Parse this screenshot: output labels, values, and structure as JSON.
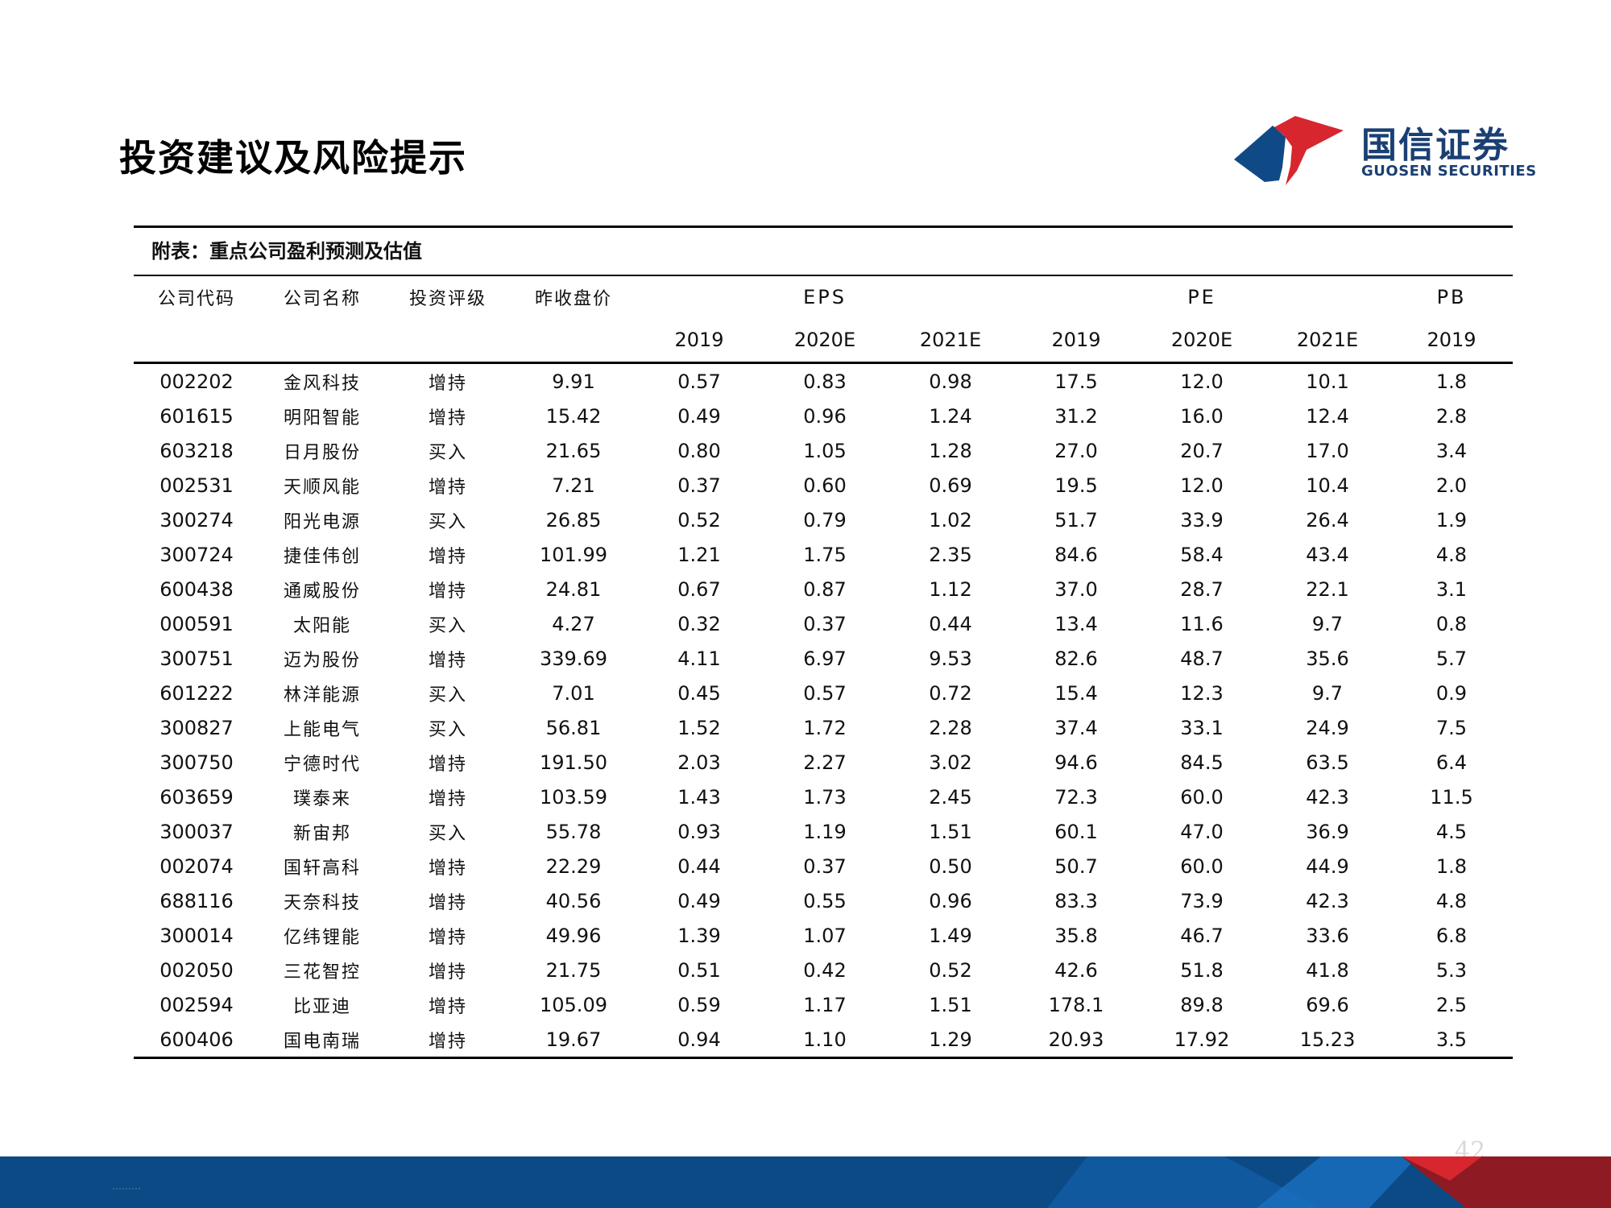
{
  "page": {
    "title": "投资建议及风险提示",
    "page_number": "42"
  },
  "logo": {
    "name_cn": "国信证券",
    "name_en": "GUOSEN SECURITIES"
  },
  "colors": {
    "brand_blue": "#0f4a86",
    "brand_red": "#d7262e",
    "footer_blue": "#0b4a85",
    "footer_red": "#8e1b24"
  },
  "table": {
    "caption": "附表：重点公司盈利预测及估值",
    "headers": {
      "code": "公司代码",
      "name": "公司名称",
      "rating": "投资评级",
      "price": "昨收盘价",
      "eps": "EPS",
      "pe": "PE",
      "pb": "PB",
      "years": [
        "2019",
        "2020E",
        "2021E",
        "2019",
        "2020E",
        "2021E",
        "2019"
      ]
    },
    "rows": [
      [
        "002202",
        "金风科技",
        "增持",
        "9.91",
        "0.57",
        "0.83",
        "0.98",
        "17.5",
        "12.0",
        "10.1",
        "1.8"
      ],
      [
        "601615",
        "明阳智能",
        "增持",
        "15.42",
        "0.49",
        "0.96",
        "1.24",
        "31.2",
        "16.0",
        "12.4",
        "2.8"
      ],
      [
        "603218",
        "日月股份",
        "买入",
        "21.65",
        "0.80",
        "1.05",
        "1.28",
        "27.0",
        "20.7",
        "17.0",
        "3.4"
      ],
      [
        "002531",
        "天顺风能",
        "增持",
        "7.21",
        "0.37",
        "0.60",
        "0.69",
        "19.5",
        "12.0",
        "10.4",
        "2.0"
      ],
      [
        "300274",
        "阳光电源",
        "买入",
        "26.85",
        "0.52",
        "0.79",
        "1.02",
        "51.7",
        "33.9",
        "26.4",
        "1.9"
      ],
      [
        "300724",
        "捷佳伟创",
        "增持",
        "101.99",
        "1.21",
        "1.75",
        "2.35",
        "84.6",
        "58.4",
        "43.4",
        "4.8"
      ],
      [
        "600438",
        "通威股份",
        "增持",
        "24.81",
        "0.67",
        "0.87",
        "1.12",
        "37.0",
        "28.7",
        "22.1",
        "3.1"
      ],
      [
        "000591",
        "太阳能",
        "买入",
        "4.27",
        "0.32",
        "0.37",
        "0.44",
        "13.4",
        "11.6",
        "9.7",
        "0.8"
      ],
      [
        "300751",
        "迈为股份",
        "增持",
        "339.69",
        "4.11",
        "6.97",
        "9.53",
        "82.6",
        "48.7",
        "35.6",
        "5.7"
      ],
      [
        "601222",
        "林洋能源",
        "买入",
        "7.01",
        "0.45",
        "0.57",
        "0.72",
        "15.4",
        "12.3",
        "9.7",
        "0.9"
      ],
      [
        "300827",
        "上能电气",
        "买入",
        "56.81",
        "1.52",
        "1.72",
        "2.28",
        "37.4",
        "33.1",
        "24.9",
        "7.5"
      ],
      [
        "300750",
        "宁德时代",
        "增持",
        "191.50",
        "2.03",
        "2.27",
        "3.02",
        "94.6",
        "84.5",
        "63.5",
        "6.4"
      ],
      [
        "603659",
        "璞泰来",
        "增持",
        "103.59",
        "1.43",
        "1.73",
        "2.45",
        "72.3",
        "60.0",
        "42.3",
        "11.5"
      ],
      [
        "300037",
        "新宙邦",
        "买入",
        "55.78",
        "0.93",
        "1.19",
        "1.51",
        "60.1",
        "47.0",
        "36.9",
        "4.5"
      ],
      [
        "002074",
        "国轩高科",
        "增持",
        "22.29",
        "0.44",
        "0.37",
        "0.50",
        "50.7",
        "60.0",
        "44.9",
        "1.8"
      ],
      [
        "688116",
        "天奈科技",
        "增持",
        "40.56",
        "0.49",
        "0.55",
        "0.96",
        "83.3",
        "73.9",
        "42.3",
        "4.8"
      ],
      [
        "300014",
        "亿纬锂能",
        "增持",
        "49.96",
        "1.39",
        "1.07",
        "1.49",
        "35.8",
        "46.7",
        "33.6",
        "6.8"
      ],
      [
        "002050",
        "三花智控",
        "增持",
        "21.75",
        "0.51",
        "0.42",
        "0.52",
        "42.6",
        "51.8",
        "41.8",
        "5.3"
      ],
      [
        "002594",
        "比亚迪",
        "增持",
        "105.09",
        "0.59",
        "1.17",
        "1.51",
        "178.1",
        "89.8",
        "69.6",
        "2.5"
      ],
      [
        "600406",
        "国电南瑞",
        "增持",
        "19.67",
        "0.94",
        "1.10",
        "1.29",
        "20.93",
        "17.92",
        "15.23",
        "3.5"
      ]
    ]
  }
}
